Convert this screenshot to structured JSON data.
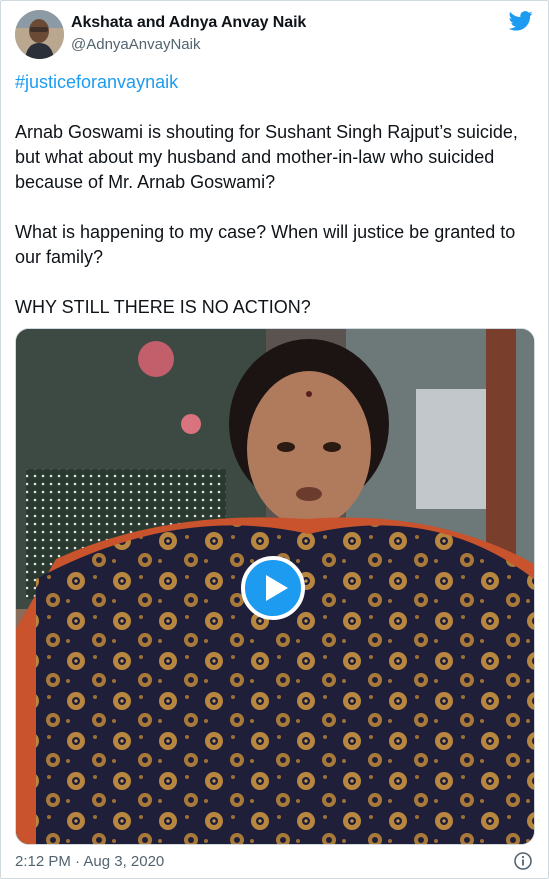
{
  "tweet": {
    "author_name": "Akshata and Adnya Anvay Naik",
    "author_handle": "@AdnyaAnvayNaik",
    "hashtag": "#justiceforanvaynaik",
    "paragraphs": [
      "Arnab Goswami is shouting for Sushant Singh Rajput’s suicide, but what about my husband and mother-in-law who suicided because of Mr. Arnab Goswami?",
      "What is happening to my case? When will justice be granted to our family?",
      "WHY STILL THERE IS NO ACTION?"
    ],
    "timestamp": "2:12 PM · Aug 3, 2020"
  },
  "icons": {
    "logo": "twitter-bird-icon",
    "play": "play-icon",
    "info": "info-icon"
  },
  "colors": {
    "accent": "#1d9bf0",
    "text": "#0f1419",
    "secondary": "#536471",
    "border": "#cfd9de"
  }
}
